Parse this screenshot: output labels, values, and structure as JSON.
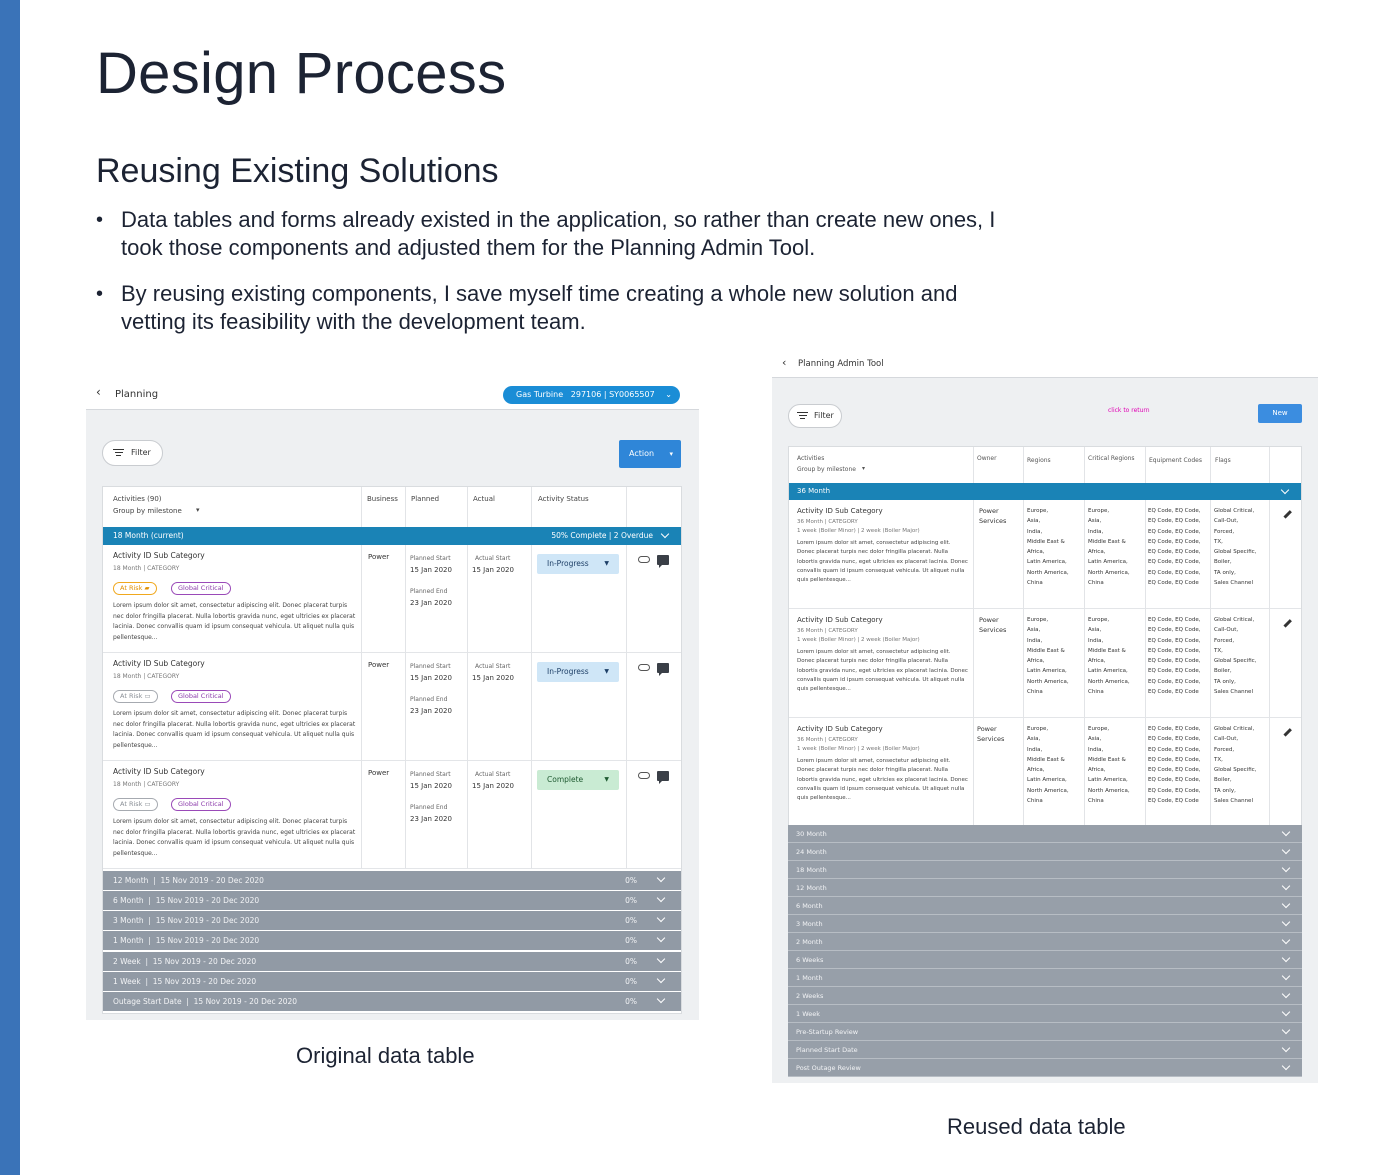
{
  "slide": {
    "title": "Design Process",
    "subtitle": "Reusing Existing Solutions",
    "bullets": [
      "Data tables and forms already existed in the application, so rather than create new ones, I took those components and adjusted them for the Planning Admin Tool.",
      "By reusing existing components, I save myself time creating a whole new solution and vetting its feasibility with the development team."
    ],
    "caption_original": "Original data table",
    "caption_reused": "Reused data table",
    "accent_color": "#3a73b8"
  },
  "original": {
    "back_icon": "chevron-left-icon",
    "back_glyph": "‹",
    "title": "Planning",
    "asset_pill": "Gas Turbine   297106 | SY0065507",
    "chevron_glyph": "⌄",
    "filter_label": "Filter",
    "action_label": "Action",
    "caret_glyph": "▾",
    "headers": {
      "activities": "Activities (90)",
      "group_by": "Group by milestone",
      "business": "Business",
      "planned": "Planned",
      "actual": "Actual",
      "status": "Activity Status"
    },
    "current_group": {
      "label": "18 Month (current)",
      "status": "50% Complete | 2 Overdue"
    },
    "rows": [
      {
        "name": "Activity ID Sub Category",
        "sub": "18 Month | CATEGORY",
        "risk": "At Risk",
        "critical": "Global Critical",
        "desc": "Lorem ipsum dolor sit amet, consectetur adipiscing elit. Donec placerat turpis nec dolor fringilla placerat. Nulla lobortis gravida nunc, eget ultricies ex placerat lacinia. Donec convallis quam id ipsum consequat vehicula. Ut aliquet nulla quis pellentesque...",
        "business": "Power",
        "planned_start_label": "Planned Start",
        "planned_start": "15 Jan 2020",
        "planned_end_label": "Planned End",
        "planned_end": "23 Jan 2020",
        "actual_start_label": "Actual Start",
        "actual_start": "15 Jan 2020",
        "status": "In-Progress"
      },
      {
        "name": "Activity ID Sub Category",
        "sub": "18 Month | CATEGORY",
        "risk": "At Risk",
        "critical": "Global Critical",
        "desc": "Lorem ipsum dolor sit amet, consectetur adipiscing elit. Donec placerat turpis nec dolor fringilla placerat. Nulla lobortis gravida nunc, eget ultricies ex placerat lacinia. Donec convallis quam id ipsum consequat vehicula. Ut aliquet nulla quis pellentesque...",
        "business": "Power",
        "planned_start_label": "Planned Start",
        "planned_start": "15 Jan 2020",
        "planned_end_label": "Planned End",
        "planned_end": "23 Jan 2020",
        "actual_start_label": "Actual Start",
        "actual_start": "15 Jan 2020",
        "status": "In-Progress"
      },
      {
        "name": "Activity ID Sub Category",
        "sub": "18 Month | CATEGORY",
        "risk": "At Risk",
        "critical": "Global Critical",
        "desc": "Lorem ipsum dolor sit amet, consectetur adipiscing elit. Donec placerat turpis nec dolor fringilla placerat. Nulla lobortis gravida nunc, eget ultricies ex placerat lacinia. Donec convallis quam id ipsum consequat vehicula. Ut aliquet nulla quis pellentesque...",
        "business": "Power",
        "planned_start_label": "Planned Start",
        "planned_start": "15 Jan 2020",
        "planned_end_label": "Planned End",
        "planned_end": "23 Jan 2020",
        "actual_start_label": "Actual Start",
        "actual_start": "15 Jan 2020",
        "status": "Complete"
      }
    ],
    "collapsed_groups": [
      {
        "label": "12 Month  |  15 Nov 2019 - 20 Dec 2020",
        "pct": "0%"
      },
      {
        "label": "6 Month  |  15 Nov 2019 - 20 Dec 2020",
        "pct": "0%"
      },
      {
        "label": "3 Month  |  15 Nov 2019 - 20 Dec 2020",
        "pct": "0%"
      },
      {
        "label": "1 Month  |  15 Nov 2019 - 20 Dec 2020",
        "pct": "0%"
      },
      {
        "label": "2 Week  |  15 Nov 2019 - 20 Dec 2020",
        "pct": "0%"
      },
      {
        "label": "1 Week  |  15 Nov 2019 - 20 Dec 2020",
        "pct": "0%"
      },
      {
        "label": "Outage Start Date  |  15 Nov 2019 - 20 Dec 2020",
        "pct": "0%"
      }
    ]
  },
  "reused": {
    "title": "Planning Admin Tool",
    "filter_label": "Filter",
    "click_return": "click to return",
    "new_label": "New",
    "headers": {
      "activities": "Activities",
      "group_by": "Group by milestone",
      "owner": "Owner",
      "regions": "Regions",
      "critical_regions": "Critical Regions",
      "equipment_codes": "Equipment Codes",
      "flags": "Flags"
    },
    "current_group": "36 Month",
    "rows": [
      {
        "name": "Activity ID Sub Category",
        "sub": "36 Month | CATEGORY",
        "sub2": "1 week (Boiler Minor) | 2 week (Boiler Major)",
        "desc": "Lorem ipsum dolor sit amet, consectetur adipiscing elit. Donec placerat turpis nec dolor fringilla placerat. Nulla lobortis gravida nunc, eget ultricies ex placerat lacinia. Donec convallis quam id ipsum consequat vehicula. Ut aliquet nulla quis pellentesque...",
        "owner": [
          "Power",
          "Services"
        ],
        "regions": [
          "Europe,",
          "Asia,",
          "India,",
          "Middle East &",
          "Africa,",
          "Latin America,",
          "North America,",
          "China"
        ],
        "critical_regions": [
          "Europe,",
          "Asia,",
          "India,",
          "Middle East &",
          "Africa,",
          "Latin America,",
          "North America,",
          "China"
        ],
        "equipment_codes": [
          "EQ Code, EQ Code,",
          "EQ Code, EQ Code,",
          "EQ Code, EQ Code,",
          "EQ Code, EQ Code,",
          "EQ Code, EQ Code,",
          "EQ Code, EQ Code,",
          "EQ Code, EQ Code,",
          "EQ Code, EQ Code"
        ],
        "flags": [
          "Global Critical,",
          "Call-Out,",
          "Forced,",
          "TX,",
          "Global Specific,",
          "Boiler,",
          "TA only,",
          "Sales Channel"
        ]
      },
      {
        "name": "Activity ID Sub Category",
        "sub": "36 Month | CATEGORY",
        "sub2": "1 week (Boiler Minor) | 2 week (Boiler Major)",
        "desc": "Lorem ipsum dolor sit amet, consectetur adipiscing elit. Donec placerat turpis nec dolor fringilla placerat. Nulla lobortis gravida nunc, eget ultricies ex placerat lacinia. Donec convallis quam id ipsum consequat vehicula. Ut aliquet nulla quis pellentesque...",
        "owner": [
          "Power",
          "Services"
        ],
        "regions": [
          "Europe,",
          "Asia,",
          "India,",
          "Middle East &",
          "Africa,",
          "Latin America,",
          "North America,",
          "China"
        ],
        "critical_regions": [
          "Europe,",
          "Asia,",
          "India,",
          "Middle East &",
          "Africa,",
          "Latin America,",
          "North America,",
          "China"
        ],
        "equipment_codes": [
          "EQ Code, EQ Code,",
          "EQ Code, EQ Code,",
          "EQ Code, EQ Code,",
          "EQ Code, EQ Code,",
          "EQ Code, EQ Code,",
          "EQ Code, EQ Code,",
          "EQ Code, EQ Code,",
          "EQ Code, EQ Code"
        ],
        "flags": [
          "Global Critical,",
          "Call-Out,",
          "Forced,",
          "TX,",
          "Global Specific,",
          "Boiler,",
          "TA only,",
          "Sales Channel"
        ]
      },
      {
        "name": "Activity ID Sub Category",
        "sub": "36 Month | CATEGORY",
        "sub2": "1 week (Boiler Minor) | 2 week (Boiler Major)",
        "desc": "Lorem ipsum dolor sit amet, consectetur adipiscing elit. Donec placerat turpis nec dolor fringilla placerat. Nulla lobortis gravida nunc, eget ultricies ex placerat lacinia. Donec convallis quam id ipsum consequat vehicula. Ut aliquet nulla quis pellentesque...",
        "owner": [
          "Power",
          "Services"
        ],
        "regions": [
          "Europe,",
          "Asia,",
          "India,",
          "Middle East &",
          "Africa,",
          "Latin America,",
          "North America,",
          "China"
        ],
        "critical_regions": [
          "Europe,",
          "Asia,",
          "India,",
          "Middle East &",
          "Africa,",
          "Latin America,",
          "North America,",
          "China"
        ],
        "equipment_codes": [
          "EQ Code, EQ Code,",
          "EQ Code, EQ Code,",
          "EQ Code, EQ Code,",
          "EQ Code, EQ Code,",
          "EQ Code, EQ Code,",
          "EQ Code, EQ Code,",
          "EQ Code, EQ Code,",
          "EQ Code, EQ Code"
        ],
        "flags": [
          "Global Critical,",
          "Call-Out,",
          "Forced,",
          "TX,",
          "Global Specific,",
          "Boiler,",
          "TA only,",
          "Sales Channel"
        ]
      }
    ],
    "collapsed_groups": [
      "30 Month",
      "24 Month",
      "18 Month",
      "12 Month",
      "6 Month",
      "3 Month",
      "2 Month",
      "6 Weeks",
      "1 Month",
      "2 Weeks",
      "1 Week",
      "Pre-Startup Review",
      "Planned Start Date",
      "Post Outage Review"
    ]
  }
}
